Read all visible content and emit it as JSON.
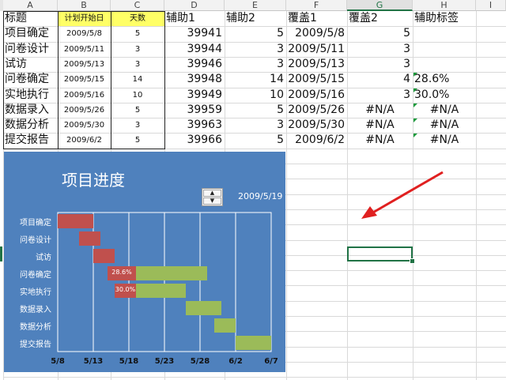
{
  "columns": [
    "A",
    "B",
    "C",
    "D",
    "E",
    "F",
    "G",
    "H",
    "I"
  ],
  "headers": [
    "标题",
    "计划开始日",
    "天数",
    "辅助1",
    "辅助2",
    "覆盖1",
    "覆盖2",
    "辅助标签"
  ],
  "rows": [
    {
      "title": "项目确定",
      "start": "2009/5/8",
      "days": "5",
      "aux1": "39941",
      "aux2": "5",
      "cover1": "2009/5/8",
      "cover2": "5",
      "label": ""
    },
    {
      "title": "问卷设计",
      "start": "2009/5/11",
      "days": "3",
      "aux1": "39944",
      "aux2": "3",
      "cover1": "2009/5/11",
      "cover2": "3",
      "label": ""
    },
    {
      "title": "试访",
      "start": "2009/5/13",
      "days": "3",
      "aux1": "39946",
      "aux2": "3",
      "cover1": "2009/5/13",
      "cover2": "3",
      "label": ""
    },
    {
      "title": "问卷确定",
      "start": "2009/5/15",
      "days": "14",
      "aux1": "39948",
      "aux2": "14",
      "cover1": "2009/5/15",
      "cover2": "4",
      "label": "28.6%"
    },
    {
      "title": "实地执行",
      "start": "2009/5/16",
      "days": "10",
      "aux1": "39949",
      "aux2": "10",
      "cover1": "2009/5/16",
      "cover2": "3",
      "label": "30.0%"
    },
    {
      "title": "数据录入",
      "start": "2009/5/26",
      "days": "5",
      "aux1": "39959",
      "aux2": "5",
      "cover1": "2009/5/26",
      "cover2": "#N/A",
      "label": "#N/A"
    },
    {
      "title": "数据分析",
      "start": "2009/5/30",
      "days": "3",
      "aux1": "39963",
      "aux2": "3",
      "cover1": "2009/5/30",
      "cover2": "#N/A",
      "label": "#N/A"
    },
    {
      "title": "提交报告",
      "start": "2009/6/2",
      "days": "5",
      "aux1": "39966",
      "aux2": "5",
      "cover1": "2009/6/2",
      "cover2": "#N/A",
      "label": "#N/A"
    }
  ],
  "chart_data": {
    "type": "bar",
    "subtype": "gantt",
    "title": "项目进度",
    "current_date": "2009/5/19",
    "x_ticks": [
      "5/8",
      "5/13",
      "5/18",
      "5/23",
      "5/28",
      "6/2",
      "6/7"
    ],
    "xlim": [
      "2009/5/8",
      "2009/6/7"
    ],
    "categories": [
      "项目确定",
      "问卷设计",
      "试访",
      "问卷确定",
      "实地执行",
      "数据录入",
      "数据分析",
      "提交报告"
    ],
    "start_dates": [
      "2009/5/8",
      "2009/5/11",
      "2009/5/13",
      "2009/5/15",
      "2009/5/16",
      "2009/5/26",
      "2009/5/30",
      "2009/6/2"
    ],
    "durations": [
      5,
      3,
      3,
      14,
      10,
      5,
      3,
      5
    ],
    "completed_days": [
      5,
      3,
      3,
      4,
      3,
      0,
      0,
      0
    ],
    "progress_labels": [
      "",
      "",
      "",
      "28.6%",
      "30.0%",
      "",
      "",
      ""
    ],
    "colors": {
      "completed": "#c0504d",
      "remaining": "#9bbb59",
      "background": "#4f81bd",
      "plot": "#4f81bd",
      "grid": "#ffffff"
    },
    "grid": true,
    "legend": "none"
  },
  "colors": {
    "header_fill": "#ffff66",
    "active_cell": "#217346",
    "arrow": "#e02020"
  },
  "spinner": {
    "up_glyph": "▲",
    "down_glyph": "▼"
  }
}
